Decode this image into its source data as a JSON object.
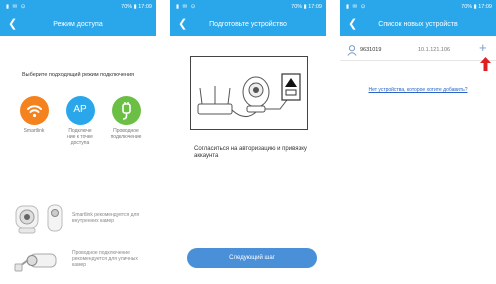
{
  "colors": {
    "accent": "#29a7ea",
    "smartlink": "#f4821f",
    "ap": "#29a7ea",
    "wired": "#6cbf45",
    "button": "#4a90d9",
    "arrow": "#e02020"
  },
  "statusbar": {
    "left_icons": "▮ ✉ ⊙",
    "right_text": "70% ▮ 17:09"
  },
  "screen1": {
    "title": "Режим доступа",
    "instruction": "Выберите подходящий режим подключения",
    "modes": [
      {
        "icon": "wifi-icon",
        "label": "Smartlink"
      },
      {
        "icon_text": "AP",
        "label_lines": [
          "Подключе",
          "ние к точке",
          "доступа"
        ]
      },
      {
        "icon": "plug-icon",
        "label_lines": [
          "Проводное",
          "подключение"
        ]
      }
    ],
    "recommend_indoor": [
      "Smartlink рекомендуется для",
      "внутренних камер"
    ],
    "recommend_outdoor": [
      "Проводное подключение",
      "рекомендуется для уличных",
      "камер"
    ]
  },
  "screen2": {
    "title": "Подготовьте устройство",
    "agree_text": "Согласиться на авторизацию и привязку аккаунта",
    "next_button": "Следующий шаг"
  },
  "screen3": {
    "title": "Список новых устройств",
    "device": {
      "id": "9631019",
      "ip": "10.1.121.106"
    },
    "plus": "+",
    "missing_link": "Нет устройства, которое хотите добавить?"
  }
}
